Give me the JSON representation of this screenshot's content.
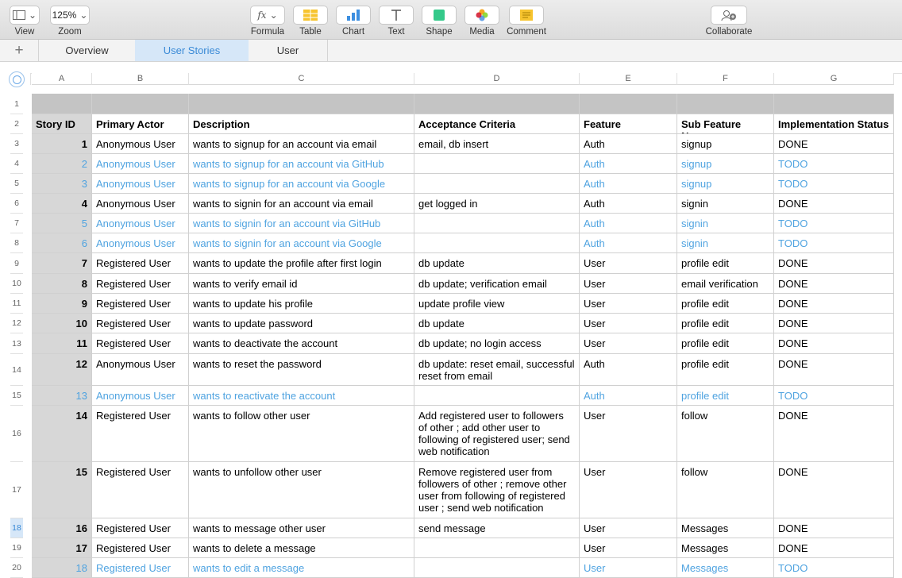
{
  "toolbar": {
    "view": "View",
    "zoom": "Zoom",
    "zoom_value": "125%",
    "formula": "Formula",
    "table": "Table",
    "chart": "Chart",
    "text": "Text",
    "shape": "Shape",
    "media": "Media",
    "comment": "Comment",
    "collaborate": "Collaborate"
  },
  "tabs": [
    "Overview",
    "User Stories",
    "User"
  ],
  "active_tab": "User Stories",
  "columns": [
    "A",
    "B",
    "C",
    "D",
    "E",
    "F",
    "G"
  ],
  "header": [
    "Story ID",
    "Primary Actor",
    "Description",
    "Acceptance Criteria",
    "Feature",
    "Sub Feature Name",
    "Implementation Status"
  ],
  "rows": [
    {
      "id": "1",
      "actor": "Anonymous User",
      "desc": "wants to signup for an account via email",
      "criteria": "email, db insert",
      "feature": "Auth",
      "sub": "signup",
      "status": "DONE"
    },
    {
      "id": "2",
      "actor": "Anonymous User",
      "desc": "wants to signup for an account via GitHub",
      "criteria": "",
      "feature": "Auth",
      "sub": "signup",
      "status": "TODO"
    },
    {
      "id": "3",
      "actor": "Anonymous User",
      "desc": "wants to signup for an account via Google",
      "criteria": "",
      "feature": "Auth",
      "sub": "signup",
      "status": "TODO"
    },
    {
      "id": "4",
      "actor": "Anonymous User",
      "desc": "wants to signin for an account via email",
      "criteria": "get logged in",
      "feature": "Auth",
      "sub": "signin",
      "status": "DONE"
    },
    {
      "id": "5",
      "actor": "Anonymous User",
      "desc": "wants to signin for an account via GitHub",
      "criteria": "",
      "feature": "Auth",
      "sub": "signin",
      "status": "TODO"
    },
    {
      "id": "6",
      "actor": "Anonymous User",
      "desc": "wants to signin for an account via Google",
      "criteria": "",
      "feature": "Auth",
      "sub": "signin",
      "status": "TODO"
    },
    {
      "id": "7",
      "actor": "Registered User",
      "desc": "wants to update the profile after first login",
      "criteria": "db update",
      "feature": "User",
      "sub": "profile edit",
      "status": "DONE"
    },
    {
      "id": "8",
      "actor": "Registered User",
      "desc": "wants to verify email id",
      "criteria": "db update; verification email",
      "feature": "User",
      "sub": "email verification",
      "status": "DONE"
    },
    {
      "id": "9",
      "actor": "Registered User",
      "desc": "wants to update his profile",
      "criteria": "update profile view",
      "feature": "User",
      "sub": "profile edit",
      "status": "DONE"
    },
    {
      "id": "10",
      "actor": "Registered User",
      "desc": "wants to update password",
      "criteria": "db update",
      "feature": "User",
      "sub": "profile edit",
      "status": "DONE"
    },
    {
      "id": "11",
      "actor": "Registered User",
      "desc": "wants to deactivate the account",
      "criteria": "db update; no login access",
      "feature": "User",
      "sub": "profile edit",
      "status": "DONE"
    },
    {
      "id": "12",
      "actor": "Anonymous User",
      "desc": "wants to reset the password",
      "criteria": "db update: reset email, successful reset from email",
      "feature": "Auth",
      "sub": "profile edit",
      "status": "DONE"
    },
    {
      "id": "13",
      "actor": "Anonymous User",
      "desc": "wants to reactivate the account",
      "criteria": "",
      "feature": "Auth",
      "sub": "profile edit",
      "status": "TODO"
    },
    {
      "id": "14",
      "actor": "Registered User",
      "desc": "wants to follow other user",
      "criteria": "Add registered user to followers of other ; add other user to following of registered user; send web notification",
      "feature": "User",
      "sub": "follow",
      "status": "DONE"
    },
    {
      "id": "15",
      "actor": "Registered User",
      "desc": "wants to unfollow other user",
      "criteria": "Remove registered user from followers of other ; remove other user from following of registered user ; send web notification",
      "feature": "User",
      "sub": "follow",
      "status": "DONE"
    },
    {
      "id": "16",
      "actor": "Registered User",
      "desc": "wants to message other user",
      "criteria": "send message",
      "feature": "User",
      "sub": "Messages",
      "status": "DONE"
    },
    {
      "id": "17",
      "actor": "Registered User",
      "desc": "wants to delete a message",
      "criteria": "",
      "feature": "User",
      "sub": "Messages",
      "status": "DONE"
    },
    {
      "id": "18",
      "actor": "Registered User",
      "desc": "wants to edit a message",
      "criteria": "",
      "feature": "User",
      "sub": "Messages",
      "status": "TODO"
    }
  ],
  "row_numbers": [
    "1",
    "2",
    "3",
    "4",
    "5",
    "6",
    "7",
    "8",
    "9",
    "10",
    "11",
    "12",
    "13",
    "14",
    "15",
    "16",
    "17",
    "18",
    "19",
    "20"
  ],
  "selected_row_number": "18",
  "colors": {
    "todo": "#4fa3e0",
    "active_tab": "#3a8ad6"
  }
}
